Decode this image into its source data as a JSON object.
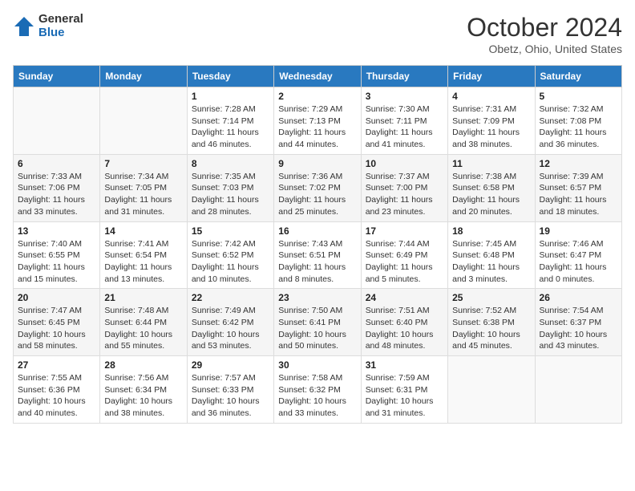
{
  "header": {
    "logo_general": "General",
    "logo_blue": "Blue",
    "title": "October 2024",
    "location": "Obetz, Ohio, United States"
  },
  "weekdays": [
    "Sunday",
    "Monday",
    "Tuesday",
    "Wednesday",
    "Thursday",
    "Friday",
    "Saturday"
  ],
  "weeks": [
    [
      {
        "day": "",
        "info": ""
      },
      {
        "day": "",
        "info": ""
      },
      {
        "day": "1",
        "info": "Sunrise: 7:28 AM\nSunset: 7:14 PM\nDaylight: 11 hours and 46 minutes."
      },
      {
        "day": "2",
        "info": "Sunrise: 7:29 AM\nSunset: 7:13 PM\nDaylight: 11 hours and 44 minutes."
      },
      {
        "day": "3",
        "info": "Sunrise: 7:30 AM\nSunset: 7:11 PM\nDaylight: 11 hours and 41 minutes."
      },
      {
        "day": "4",
        "info": "Sunrise: 7:31 AM\nSunset: 7:09 PM\nDaylight: 11 hours and 38 minutes."
      },
      {
        "day": "5",
        "info": "Sunrise: 7:32 AM\nSunset: 7:08 PM\nDaylight: 11 hours and 36 minutes."
      }
    ],
    [
      {
        "day": "6",
        "info": "Sunrise: 7:33 AM\nSunset: 7:06 PM\nDaylight: 11 hours and 33 minutes."
      },
      {
        "day": "7",
        "info": "Sunrise: 7:34 AM\nSunset: 7:05 PM\nDaylight: 11 hours and 31 minutes."
      },
      {
        "day": "8",
        "info": "Sunrise: 7:35 AM\nSunset: 7:03 PM\nDaylight: 11 hours and 28 minutes."
      },
      {
        "day": "9",
        "info": "Sunrise: 7:36 AM\nSunset: 7:02 PM\nDaylight: 11 hours and 25 minutes."
      },
      {
        "day": "10",
        "info": "Sunrise: 7:37 AM\nSunset: 7:00 PM\nDaylight: 11 hours and 23 minutes."
      },
      {
        "day": "11",
        "info": "Sunrise: 7:38 AM\nSunset: 6:58 PM\nDaylight: 11 hours and 20 minutes."
      },
      {
        "day": "12",
        "info": "Sunrise: 7:39 AM\nSunset: 6:57 PM\nDaylight: 11 hours and 18 minutes."
      }
    ],
    [
      {
        "day": "13",
        "info": "Sunrise: 7:40 AM\nSunset: 6:55 PM\nDaylight: 11 hours and 15 minutes."
      },
      {
        "day": "14",
        "info": "Sunrise: 7:41 AM\nSunset: 6:54 PM\nDaylight: 11 hours and 13 minutes."
      },
      {
        "day": "15",
        "info": "Sunrise: 7:42 AM\nSunset: 6:52 PM\nDaylight: 11 hours and 10 minutes."
      },
      {
        "day": "16",
        "info": "Sunrise: 7:43 AM\nSunset: 6:51 PM\nDaylight: 11 hours and 8 minutes."
      },
      {
        "day": "17",
        "info": "Sunrise: 7:44 AM\nSunset: 6:49 PM\nDaylight: 11 hours and 5 minutes."
      },
      {
        "day": "18",
        "info": "Sunrise: 7:45 AM\nSunset: 6:48 PM\nDaylight: 11 hours and 3 minutes."
      },
      {
        "day": "19",
        "info": "Sunrise: 7:46 AM\nSunset: 6:47 PM\nDaylight: 11 hours and 0 minutes."
      }
    ],
    [
      {
        "day": "20",
        "info": "Sunrise: 7:47 AM\nSunset: 6:45 PM\nDaylight: 10 hours and 58 minutes."
      },
      {
        "day": "21",
        "info": "Sunrise: 7:48 AM\nSunset: 6:44 PM\nDaylight: 10 hours and 55 minutes."
      },
      {
        "day": "22",
        "info": "Sunrise: 7:49 AM\nSunset: 6:42 PM\nDaylight: 10 hours and 53 minutes."
      },
      {
        "day": "23",
        "info": "Sunrise: 7:50 AM\nSunset: 6:41 PM\nDaylight: 10 hours and 50 minutes."
      },
      {
        "day": "24",
        "info": "Sunrise: 7:51 AM\nSunset: 6:40 PM\nDaylight: 10 hours and 48 minutes."
      },
      {
        "day": "25",
        "info": "Sunrise: 7:52 AM\nSunset: 6:38 PM\nDaylight: 10 hours and 45 minutes."
      },
      {
        "day": "26",
        "info": "Sunrise: 7:54 AM\nSunset: 6:37 PM\nDaylight: 10 hours and 43 minutes."
      }
    ],
    [
      {
        "day": "27",
        "info": "Sunrise: 7:55 AM\nSunset: 6:36 PM\nDaylight: 10 hours and 40 minutes."
      },
      {
        "day": "28",
        "info": "Sunrise: 7:56 AM\nSunset: 6:34 PM\nDaylight: 10 hours and 38 minutes."
      },
      {
        "day": "29",
        "info": "Sunrise: 7:57 AM\nSunset: 6:33 PM\nDaylight: 10 hours and 36 minutes."
      },
      {
        "day": "30",
        "info": "Sunrise: 7:58 AM\nSunset: 6:32 PM\nDaylight: 10 hours and 33 minutes."
      },
      {
        "day": "31",
        "info": "Sunrise: 7:59 AM\nSunset: 6:31 PM\nDaylight: 10 hours and 31 minutes."
      },
      {
        "day": "",
        "info": ""
      },
      {
        "day": "",
        "info": ""
      }
    ]
  ]
}
